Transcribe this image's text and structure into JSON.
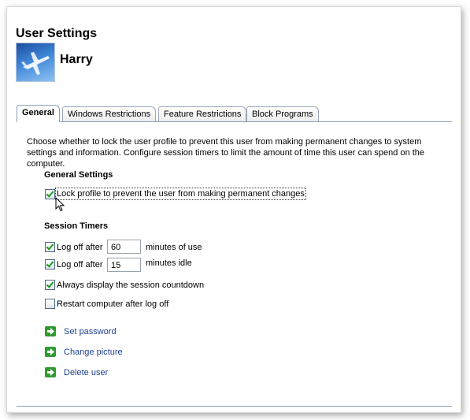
{
  "page": {
    "title": "User Settings",
    "username": "Harry"
  },
  "tabs": [
    {
      "label": "General",
      "active": true
    },
    {
      "label": "Windows Restrictions",
      "active": false
    },
    {
      "label": "Feature Restrictions",
      "active": false
    },
    {
      "label": "Block Programs",
      "active": false
    }
  ],
  "general": {
    "description": "Choose whether to lock the user profile to prevent this user from making permanent changes to system settings and information. Configure session timers to limit the amount of time this user can spend on the computer.",
    "settings_heading": "General Settings",
    "lock_profile_label": "Lock profile to prevent the user from making permanent changes",
    "lock_profile_checked": true
  },
  "session_timers": {
    "heading": "Session Timers",
    "logoff_use_label": "Log off after",
    "logoff_use_value": "60",
    "logoff_use_suffix": "minutes of use",
    "logoff_use_checked": true,
    "logoff_idle_label": "Log off after",
    "logoff_idle_value": "15",
    "logoff_idle_suffix": "minutes idle",
    "logoff_idle_checked": true,
    "countdown_label": "Always display the session countdown",
    "countdown_checked": true,
    "restart_label": "Restart computer after log off",
    "restart_checked": false
  },
  "links": {
    "set_password": "Set password",
    "change_picture": "Change picture",
    "delete_user": "Delete user"
  },
  "icons": {
    "link_arrow": "green-arrow-icon",
    "avatar": "airplane-avatar"
  },
  "colors": {
    "link": "#1d3f8f",
    "check": "#1a9a1a",
    "tab_border": "#8aa0bc"
  }
}
